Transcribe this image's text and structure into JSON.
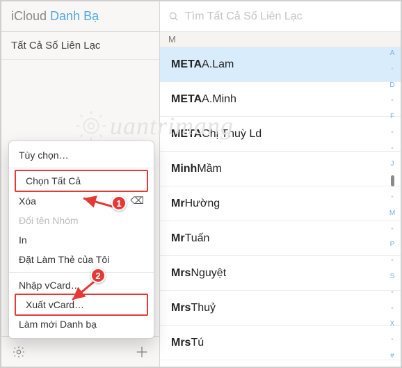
{
  "sidebar": {
    "header_prefix": "iCloud",
    "header_accent": "Danh Bạ",
    "all_contacts": "Tất Cả Số Liên Lạc"
  },
  "search": {
    "placeholder": "Tìm Tất Cả Số Liên Lạc"
  },
  "section_letter": "M",
  "contacts": [
    {
      "prefix": "META",
      "name": "A.Lam",
      "selected": true
    },
    {
      "prefix": "META",
      "name": "A.Minh",
      "selected": false
    },
    {
      "prefix": "META",
      "name": "Chị Thuỳ Ld",
      "selected": false
    },
    {
      "prefix": "Minh",
      "name": "Mầm",
      "selected": false
    },
    {
      "prefix": "Mr",
      "name": "Hường",
      "selected": false
    },
    {
      "prefix": "Mr",
      "name": "Tuấn",
      "selected": false
    },
    {
      "prefix": "Mrs",
      "name": "Nguyệt",
      "selected": false
    },
    {
      "prefix": "Mrs",
      "name": "Thuỷ",
      "selected": false
    },
    {
      "prefix": "Mrs",
      "name": "Tú",
      "selected": false
    }
  ],
  "index_rail": [
    "A",
    "•",
    "D",
    "•",
    "F",
    "•",
    "•",
    "J",
    "•",
    "M",
    "•",
    "P",
    "•",
    "S",
    "•",
    "•",
    "X",
    "•",
    "#"
  ],
  "menu": {
    "preferences": "Tùy chọn…",
    "select_all": "Chọn Tất Cả",
    "delete": "Xóa",
    "rename_group": "Đổi tên Nhóm",
    "print": "In",
    "make_my_card": "Đặt Làm Thẻ của Tôi",
    "import_vcard": "Nhập vCard…",
    "export_vcard": "Xuất vCard…",
    "refresh": "Làm mới Danh bạ"
  },
  "annotations": {
    "a1": "1",
    "a2": "2"
  },
  "watermark": "uantrimang"
}
